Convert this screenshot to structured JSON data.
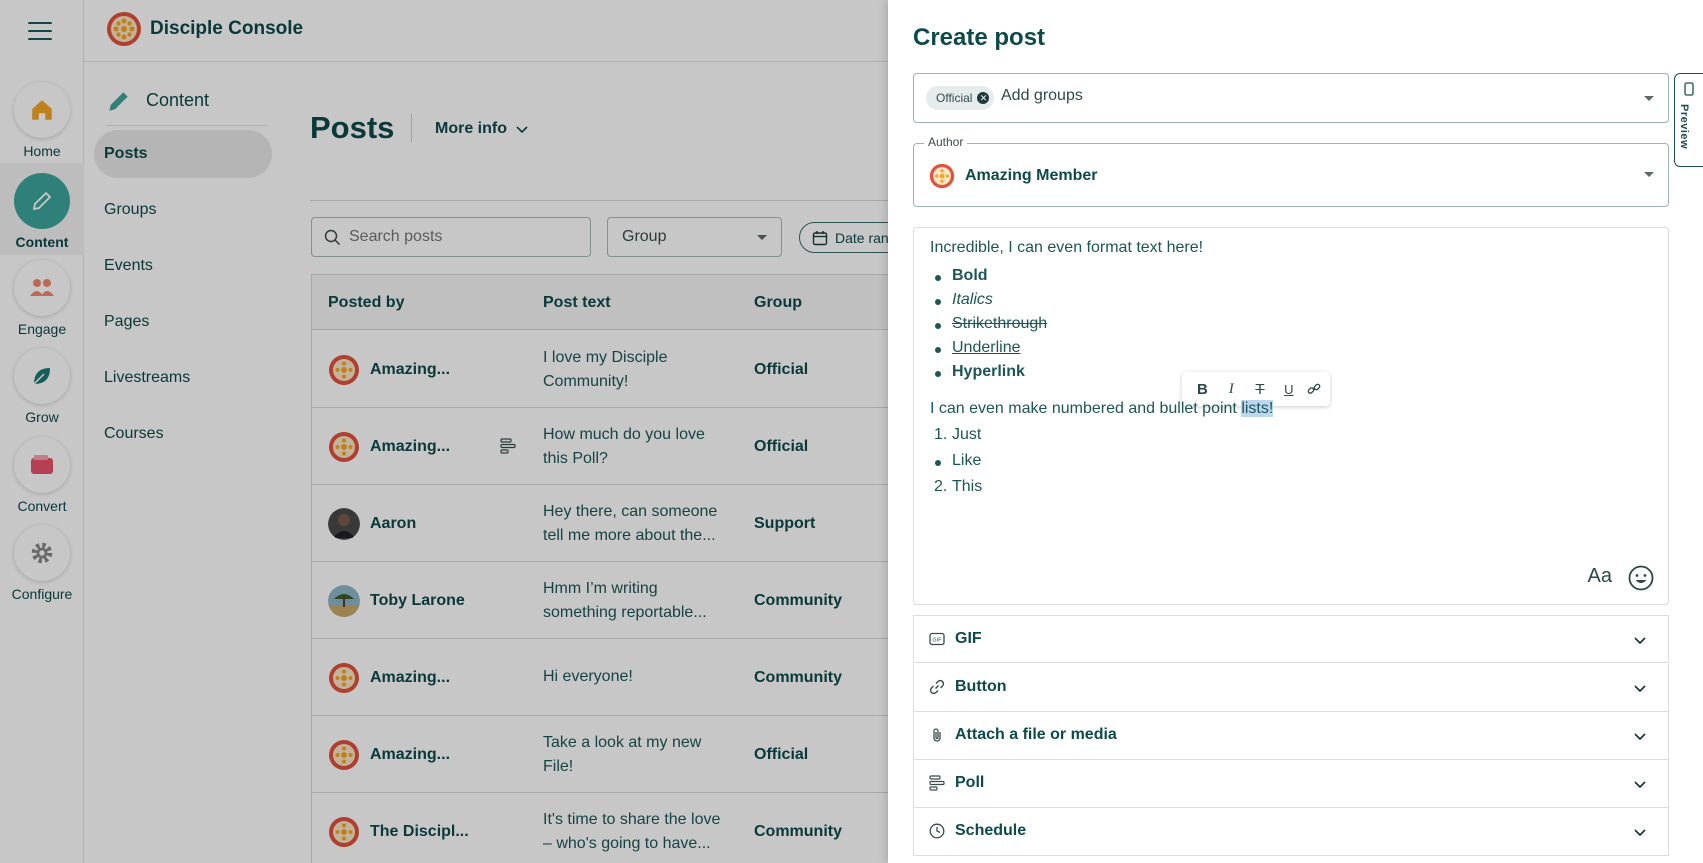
{
  "rail": {
    "items": [
      {
        "label": "Home",
        "icon": "home-icon"
      },
      {
        "label": "Content",
        "icon": "pencil-icon"
      },
      {
        "label": "Engage",
        "icon": "people-icon"
      },
      {
        "label": "Grow",
        "icon": "leaf-icon"
      },
      {
        "label": "Convert",
        "icon": "wallet-icon"
      },
      {
        "label": "Configure",
        "icon": "gear-icon"
      }
    ]
  },
  "header": {
    "app_name": "Disciple Console"
  },
  "subnav": {
    "section": "Content",
    "items": [
      "Posts",
      "Groups",
      "Events",
      "Pages",
      "Livestreams",
      "Courses"
    ]
  },
  "main": {
    "title": "Posts",
    "more_info": "More info",
    "search_placeholder": "Search posts",
    "group_filter": "Group",
    "date_filter": "Date ran",
    "columns": [
      "Posted by",
      "Post text",
      "Group"
    ],
    "rows": [
      {
        "poster": "Amazing...",
        "text": "I love my Disciple Community!",
        "group": "Official"
      },
      {
        "poster": "Amazing...",
        "text": "How much do you love this Poll?",
        "group": "Official"
      },
      {
        "poster": "Aaron",
        "text": "Hey there, can someone tell me more about the...",
        "group": "Support"
      },
      {
        "poster": "Toby Larone",
        "text": "Hmm I’m writing something reportable...",
        "group": "Community"
      },
      {
        "poster": "Amazing...",
        "text": "Hi everyone!",
        "group": "Community"
      },
      {
        "poster": "Amazing...",
        "text": "Take a look at my new File!",
        "group": "Official"
      },
      {
        "poster": "The Discipl...",
        "text": "It's time to share the love – who's going to have...",
        "group": "Community"
      }
    ]
  },
  "drawer": {
    "title": "Create post",
    "groups_chip": "Official",
    "groups_placeholder": "Add groups",
    "author_label": "Author",
    "author_name": "Amazing Member",
    "editor": {
      "intro": "Incredible, I can even format text here!",
      "bold": "Bold",
      "italics": "Italics",
      "strike": "Strikethrough",
      "underline": "Underline",
      "hyperlink": "Hyperlink",
      "line2_pre": "I can even make numbered and bullet point ",
      "line2_sel": "lists!",
      "n1_num": "1.",
      "n1": "Just",
      "b1": "Like",
      "n2_num": "2.",
      "n2": "This",
      "text_style": "Aa"
    },
    "toolbar": {
      "bold": "B",
      "italic": "I",
      "strike": "T",
      "underline": "U"
    },
    "sections": [
      "GIF",
      "Button",
      "Attach a file or media",
      "Poll",
      "Schedule"
    ],
    "preview_label": "Preview"
  },
  "colors": {
    "brand_teal": "#0f4a4a",
    "accent": "#3da59b",
    "logo_orange": "#e0533d"
  }
}
